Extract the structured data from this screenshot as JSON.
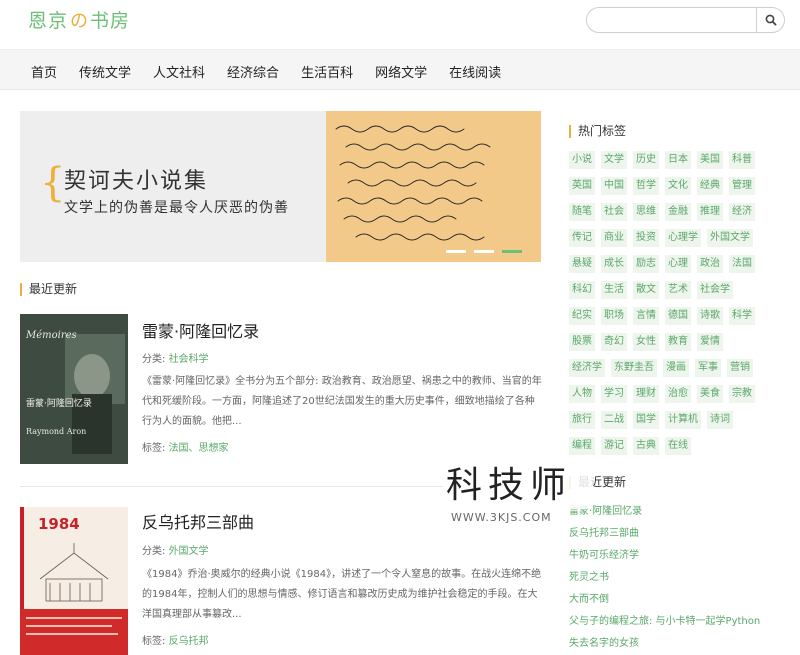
{
  "brand": {
    "logo_a": "恩京",
    "logo_mid": "の",
    "logo_b": "书房"
  },
  "search": {
    "placeholder": ""
  },
  "nav": [
    "首页",
    "传统文学",
    "人文社科",
    "经济综合",
    "生活百科",
    "网络文学",
    "在线阅读"
  ],
  "banner": {
    "title": "契诃夫小说集",
    "subtitle": "文学上的伪善是最令人厌恶的伪善"
  },
  "sections": {
    "latest": "最近更新",
    "hot_tags": "热门标签",
    "recent": "最近更新"
  },
  "books": [
    {
      "title": "雷蒙·阿隆回忆录",
      "category_label": "分类: ",
      "category": "社会科学",
      "desc": "《雷蒙·阿隆回忆录》全书分为五个部分: 政治教育、政治愿望、祸患之中的教师、当官的年代和死缓阶段。一方面，阿隆追述了20世纪法国发生的重大历史事件，细致地描绘了各种行为人的面貌。他把...",
      "tags_label": "标签: ",
      "tags": "法国、思想家",
      "cover_title": "Mémoires",
      "cover_cn": "雷蒙·阿隆回忆录",
      "cover_author": "Raymond Aron"
    },
    {
      "title": "反乌托邦三部曲",
      "category_label": "分类: ",
      "category": "外国文学",
      "desc": "《1984》乔治·奥威尔的经典小说《1984》，讲述了一个令人窒息的故事。在战火连绵不绝的1984年，控制人们的思想与情感、修订语言和篡改历史成为维护社会稳定的手段。在大洋国真理部从事篡改...",
      "tags_label": "标签: ",
      "tags": "反乌托邦",
      "cover_title": "1984"
    }
  ],
  "tags": [
    "小说",
    "文学",
    "历史",
    "日本",
    "美国",
    "科普",
    "英国",
    "中国",
    "哲学",
    "文化",
    "经典",
    "管理",
    "随笔",
    "社会",
    "思维",
    "金融",
    "推理",
    "经济",
    "传记",
    "商业",
    "投资",
    "心理学",
    "外国文学",
    "悬疑",
    "成长",
    "励志",
    "心理",
    "政治",
    "法国",
    "科幻",
    "生活",
    "散文",
    "艺术",
    "社会学",
    "纪实",
    "职场",
    "言情",
    "德国",
    "诗歌",
    "科学",
    "股票",
    "奇幻",
    "女性",
    "教育",
    "爱情",
    "经济学",
    "东野圭吾",
    "漫画",
    "军事",
    "营销",
    "人物",
    "学习",
    "理财",
    "治愈",
    "美食",
    "宗教",
    "旅行",
    "二战",
    "国学",
    "计算机",
    "诗词",
    "编程",
    "游记",
    "古典",
    "在线"
  ],
  "recent": [
    "雷蒙·阿隆回忆录",
    "反乌托邦三部曲",
    "牛奶可乐经济学",
    "死灵之书",
    "大而不倒",
    "父与子的编程之旅: 与小卡特一起学Python",
    "失去名字的女孩"
  ],
  "watermark": {
    "big": "科技师",
    "small": "WWW.3KJS.COM"
  },
  "colors": {
    "accent": "#6cbf78",
    "highlight": "#f0ad3a"
  }
}
